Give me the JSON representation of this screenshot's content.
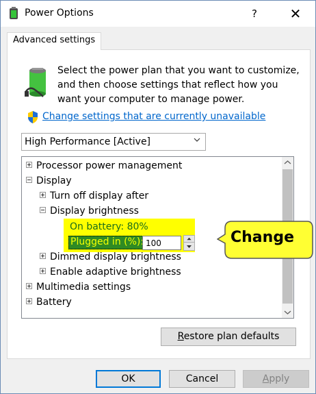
{
  "window": {
    "title": "Power Options",
    "help": "?",
    "close": "✕"
  },
  "tab": {
    "label": "Advanced settings"
  },
  "description": "Select the power plan that you want to customize, and then choose settings that reflect how you want your computer to manage power.",
  "change_link": "Change settings that are currently unavailable",
  "plan_select": {
    "value": "High Performance [Active]"
  },
  "tree": {
    "processor": "Processor power management",
    "display": "Display",
    "turn_off": "Turn off display after",
    "brightness": "Display brightness",
    "on_battery_label": "On battery:",
    "on_battery_value": "80%",
    "plugged_label": "Plugged in (%):",
    "plugged_value": "100",
    "dimmed": "Dimmed display brightness",
    "adaptive": "Enable adaptive brightness",
    "multimedia": "Multimedia settings",
    "battery": "Battery"
  },
  "restore": {
    "label_first": "R",
    "label_rest": "estore plan defaults"
  },
  "callout": {
    "text": "Change"
  },
  "footer": {
    "ok": "OK",
    "cancel": "Cancel",
    "apply_first": "A",
    "apply_rest": "pply"
  },
  "colors": {
    "highlight": "#ffff00",
    "link": "#0066cc",
    "plugged_bg": "#2f8b23",
    "callout_fill": "#ffff33"
  }
}
